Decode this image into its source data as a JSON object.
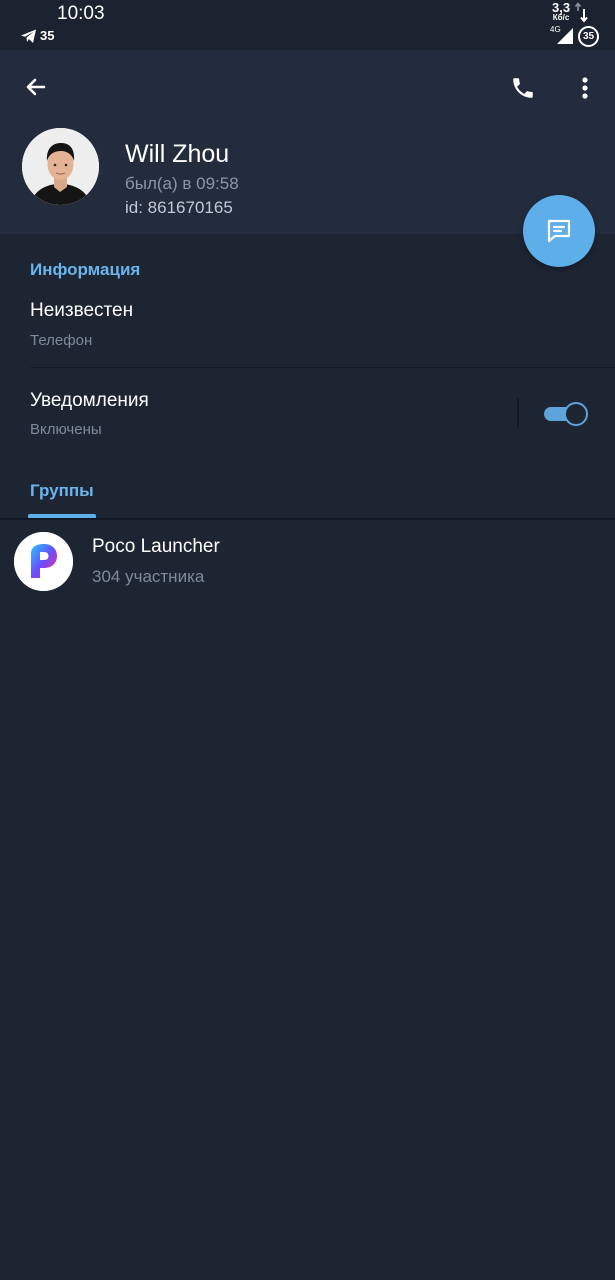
{
  "status_bar": {
    "time": "10:03",
    "notification_count": "35",
    "net_speed": "3,3",
    "net_unit": "Кб/с",
    "network_type": "4G",
    "battery": "35"
  },
  "header": {
    "name": "Will Zhou",
    "last_seen": "был(а) в 09:58",
    "user_id": "id: 861670165"
  },
  "info": {
    "section_title": "Информация",
    "phone_value": "Неизвестен",
    "phone_label": "Телефон",
    "notifications_label": "Уведомления",
    "notifications_status": "Включены",
    "notifications_on": true
  },
  "tabs": [
    {
      "label": "Группы",
      "active": true
    }
  ],
  "groups": [
    {
      "name": "Poco Launcher",
      "members": "304 участника"
    }
  ],
  "colors": {
    "background": "#1d2533",
    "header": "#222c3d",
    "accent": "#5eaee9",
    "section_title": "#6bb4ed"
  },
  "icons": [
    "telegram-icon",
    "back-arrow-icon",
    "phone-icon",
    "more-vert-icon",
    "message-icon",
    "poco-logo-icon"
  ]
}
